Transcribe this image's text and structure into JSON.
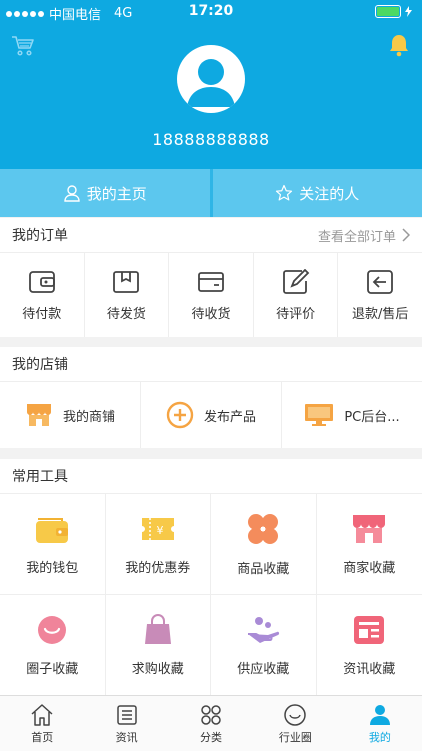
{
  "status_bar": {
    "carrier": "中国电信",
    "network": "4G",
    "time": "17:20"
  },
  "header": {
    "phone": "18888888888",
    "cart_icon": "cart-icon",
    "bell_icon": "bell-icon",
    "bg_color": "#0ea9e1"
  },
  "profile_tabs": [
    {
      "label": "我的主页",
      "icon": "user-icon"
    },
    {
      "label": "关注的人",
      "icon": "star-icon"
    }
  ],
  "orders": {
    "title": "我的订单",
    "view_all": "查看全部订单",
    "items": [
      {
        "label": "待付款",
        "icon": "wallet-icon"
      },
      {
        "label": "待发货",
        "icon": "box-icon"
      },
      {
        "label": "待收货",
        "icon": "card-icon"
      },
      {
        "label": "待评价",
        "icon": "edit-icon"
      },
      {
        "label": "退款/售后",
        "icon": "return-icon"
      }
    ]
  },
  "store": {
    "title": "我的店铺",
    "items": [
      {
        "label": "我的商铺",
        "icon": "shop-icon"
      },
      {
        "label": "发布产品",
        "icon": "plus-circle-icon"
      },
      {
        "label": "PC后台...",
        "icon": "monitor-icon"
      }
    ]
  },
  "tools": {
    "title": "常用工具",
    "items": [
      {
        "label": "我的钱包",
        "icon": "wallet-icon"
      },
      {
        "label": "我的优惠券",
        "icon": "coupon-icon"
      },
      {
        "label": "商品收藏",
        "icon": "clover-icon"
      },
      {
        "label": "商家收藏",
        "icon": "shop-icon"
      },
      {
        "label": "圈子收藏",
        "icon": "smile-icon"
      },
      {
        "label": "求购收藏",
        "icon": "bag-icon"
      },
      {
        "label": "供应收藏",
        "icon": "hand-icon"
      },
      {
        "label": "资讯收藏",
        "icon": "news-icon"
      }
    ]
  },
  "tabbar": [
    {
      "label": "首页",
      "icon": "home-icon",
      "active": false
    },
    {
      "label": "资讯",
      "icon": "news-icon",
      "active": false
    },
    {
      "label": "分类",
      "icon": "category-icon",
      "active": false
    },
    {
      "label": "行业圈",
      "icon": "circle-icon",
      "active": false
    },
    {
      "label": "我的",
      "icon": "person-icon",
      "active": true
    }
  ]
}
